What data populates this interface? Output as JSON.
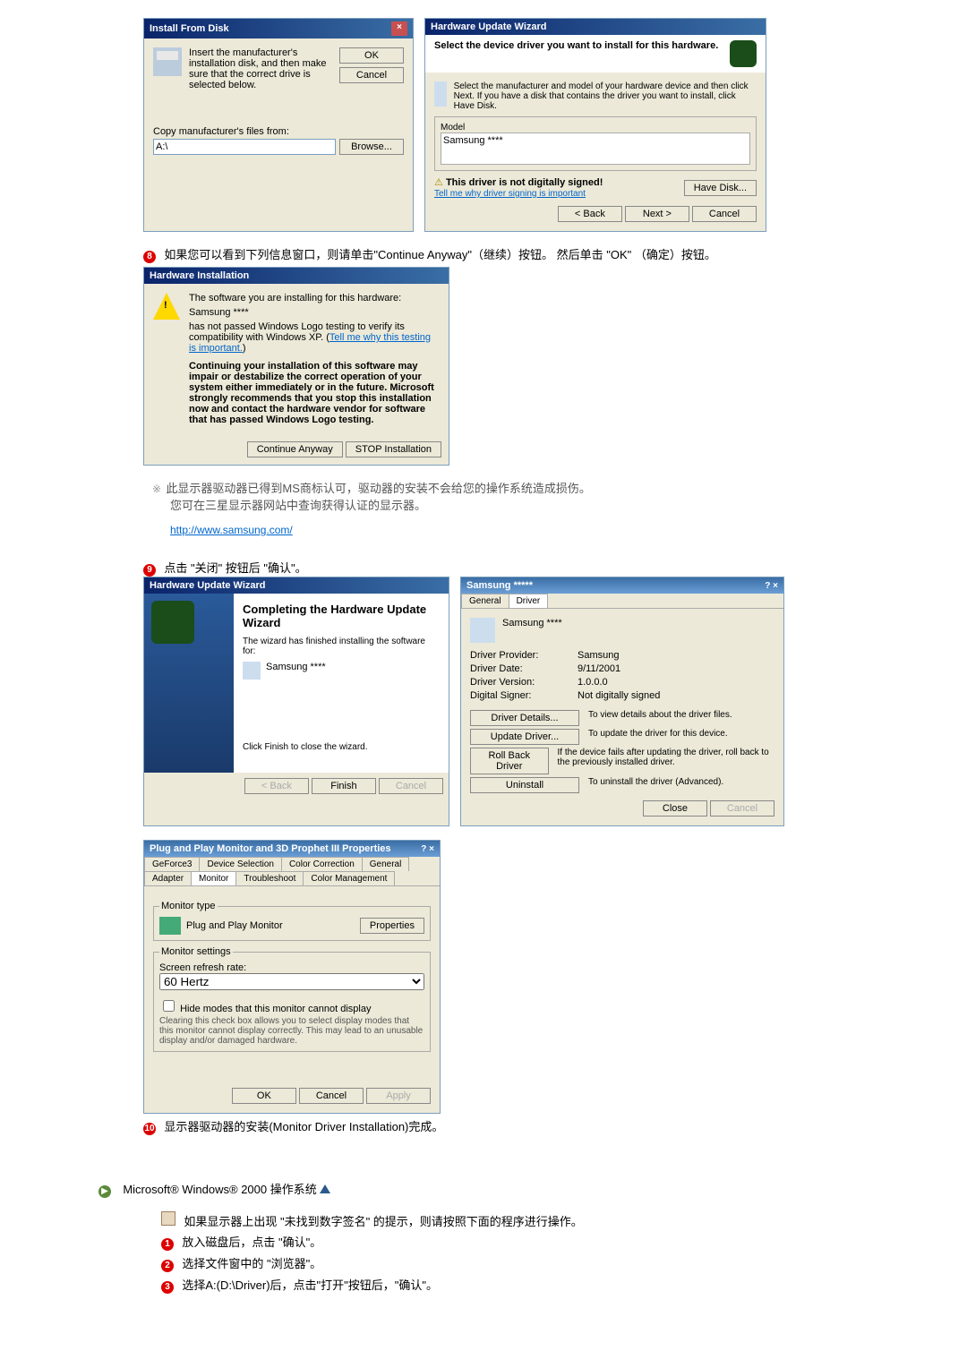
{
  "installDisk": {
    "title": "Install From Disk",
    "msg": "Insert the manufacturer's installation disk, and then make sure that the correct drive is selected below.",
    "ok": "OK",
    "cancel": "Cancel",
    "copyFrom": "Copy manufacturer's files from:",
    "path": "A:\\",
    "browse": "Browse..."
  },
  "hwWizardSelect": {
    "title": "Hardware Update Wizard",
    "heading": "Select the device driver you want to install for this hardware.",
    "sub": "Select the manufacturer and model of your hardware device and then click Next. If you have a disk that contains the driver you want to install, click Have Disk.",
    "modelLbl": "Model",
    "model": "Samsung ****",
    "notSigned": "This driver is not digitally signed!",
    "tellMe": "Tell me why driver signing is important",
    "haveDisk": "Have Disk...",
    "back": "< Back",
    "next": "Next >",
    "cancel": "Cancel"
  },
  "step8": "如果您可以看到下列信息窗口，则请单击\"Continue Anyway\"（继续）按钮。 然后单击 \"OK\" （确定）按钮。",
  "hwInstall": {
    "title": "Hardware Installation",
    "line1": "The software you are installing for this hardware:",
    "line2": "Samsung ****",
    "line3": "has not passed Windows Logo testing to verify its compatibility with Windows XP. (",
    "line3link": "Tell me why this testing is important.",
    "line3end": ")",
    "warn": "Continuing your installation of this software may impair or destabilize the correct operation of your system either immediately or in the future. Microsoft strongly recommends that you stop this installation now and contact the hardware vendor for software that has passed Windows Logo testing.",
    "cont": "Continue Anyway",
    "stop": "STOP Installation"
  },
  "noteMS": "此显示器驱动器已得到MS商标认可，驱动器的安装不会给您的操作系统造成损伤。",
  "noteSamsung": "您可在三星显示器网站中查询获得认证的显示器。",
  "url": "http://www.samsung.com/",
  "step9": "点击 \"关闭\" 按钮后 \"确认\"。",
  "completing": {
    "title": "Hardware Update Wizard",
    "heading": "Completing the Hardware Update Wizard",
    "sub": "The wizard has finished installing the software for:",
    "device": "Samsung ****",
    "footer": "Click Finish to close the wizard.",
    "back": "< Back",
    "finish": "Finish",
    "cancel": "Cancel"
  },
  "driverProps": {
    "title": "Samsung *****",
    "tabGeneral": "General",
    "tabDriver": "Driver",
    "device": "Samsung ****",
    "provider": "Driver Provider:",
    "providerV": "Samsung",
    "date": "Driver Date:",
    "dateV": "9/11/2001",
    "version": "Driver Version:",
    "versionV": "1.0.0.0",
    "signer": "Digital Signer:",
    "signerV": "Not digitally signed",
    "details": "Driver Details...",
    "detailsD": "To view details about the driver files.",
    "update": "Update Driver...",
    "updateD": "To update the driver for this device.",
    "rollback": "Roll Back Driver",
    "rollbackD": "If the device fails after updating the driver, roll back to the previously installed driver.",
    "uninstall": "Uninstall",
    "uninstallD": "To uninstall the driver (Advanced).",
    "close": "Close",
    "cancel": "Cancel"
  },
  "monitorProps": {
    "title": "Plug and Play Monitor and 3D Prophet III Properties",
    "tabs": [
      "GeForce3",
      "Device Selection",
      "Color Correction",
      "General",
      "Adapter",
      "Monitor",
      "Troubleshoot",
      "Color Management"
    ],
    "monType": "Monitor type",
    "monName": "Plug and Play Monitor",
    "properties": "Properties",
    "monSettings": "Monitor settings",
    "refresh": "Screen refresh rate:",
    "refreshV": "60 Hertz",
    "hide": "Hide modes that this monitor cannot display",
    "hideDesc": "Clearing this check box allows you to select display modes that this monitor cannot display correctly. This may lead to an unusable display and/or damaged hardware.",
    "ok": "OK",
    "cancel": "Cancel",
    "apply": "Apply"
  },
  "step10": "显示器驱动器的安装(Monitor Driver Installation)完成。",
  "win2000": {
    "heading": "Microsoft® Windows® 2000 操作系统",
    "intro": "如果显示器上出现 \"未找到数字签名\" 的提示，则请按照下面的程序进行操作。",
    "s1": "放入磁盘后，点击 \"确认\"。",
    "s2": "选择文件窗中的 \"浏览器\"。",
    "s3": "选择A:(D:\\Driver)后，点击\"打开\"按钮后，\"确认\"。"
  }
}
